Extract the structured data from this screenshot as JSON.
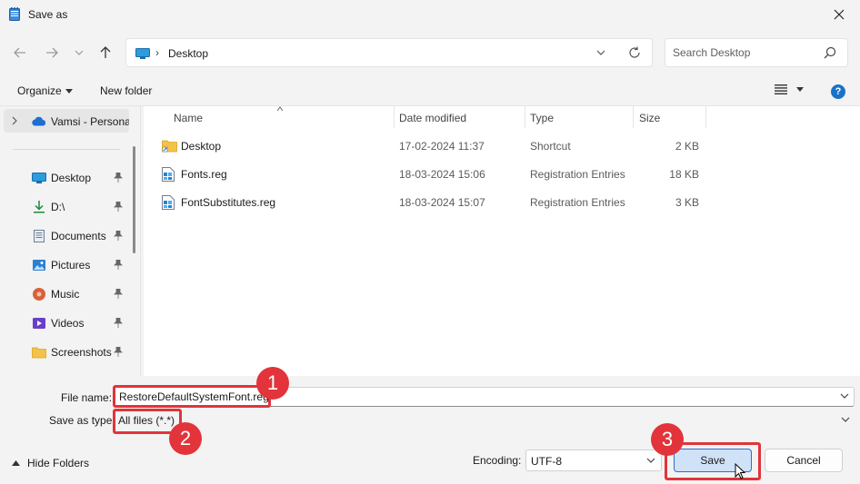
{
  "window": {
    "title": "Save as"
  },
  "address": {
    "crumb": "Desktop",
    "separator": "›"
  },
  "search": {
    "placeholder": "Search Desktop"
  },
  "toolbar": {
    "organize": "Organize",
    "new_folder": "New folder",
    "help": "?"
  },
  "sidebar": {
    "onedrive_label": "Vamsi - Personal",
    "items": [
      {
        "label": "Desktop",
        "icon": "desktop-icon"
      },
      {
        "label": "D:\\",
        "icon": "downloads-icon"
      },
      {
        "label": "Documents",
        "icon": "documents-icon"
      },
      {
        "label": "Pictures",
        "icon": "pictures-icon"
      },
      {
        "label": "Music",
        "icon": "music-icon"
      },
      {
        "label": "Videos",
        "icon": "videos-icon"
      },
      {
        "label": "Screenshots",
        "icon": "folder-icon"
      }
    ]
  },
  "columns": {
    "name": "Name",
    "date": "Date modified",
    "type": "Type",
    "size": "Size"
  },
  "files": [
    {
      "name": "Desktop",
      "date": "17-02-2024 11:37",
      "type": "Shortcut",
      "size": "2 KB",
      "icon": "folder-shortcut-icon"
    },
    {
      "name": "Fonts.reg",
      "date": "18-03-2024 15:06",
      "type": "Registration Entries",
      "size": "18 KB",
      "icon": "registry-file-icon"
    },
    {
      "name": "FontSubstitutes.reg",
      "date": "18-03-2024 15:07",
      "type": "Registration Entries",
      "size": "3 KB",
      "icon": "registry-file-icon"
    }
  ],
  "form": {
    "file_name_label": "File name:",
    "file_name_value": "RestoreDefaultSystemFont.reg",
    "save_as_type_label": "Save as type:",
    "save_as_type_value": "All files  (*.*)",
    "encoding_label": "Encoding:",
    "encoding_value": "UTF-8",
    "hide_folders": "Hide Folders",
    "save": "Save",
    "cancel": "Cancel"
  },
  "annotations": {
    "badge1": "1",
    "badge2": "2",
    "badge3": "3",
    "color": "#e2343a"
  }
}
